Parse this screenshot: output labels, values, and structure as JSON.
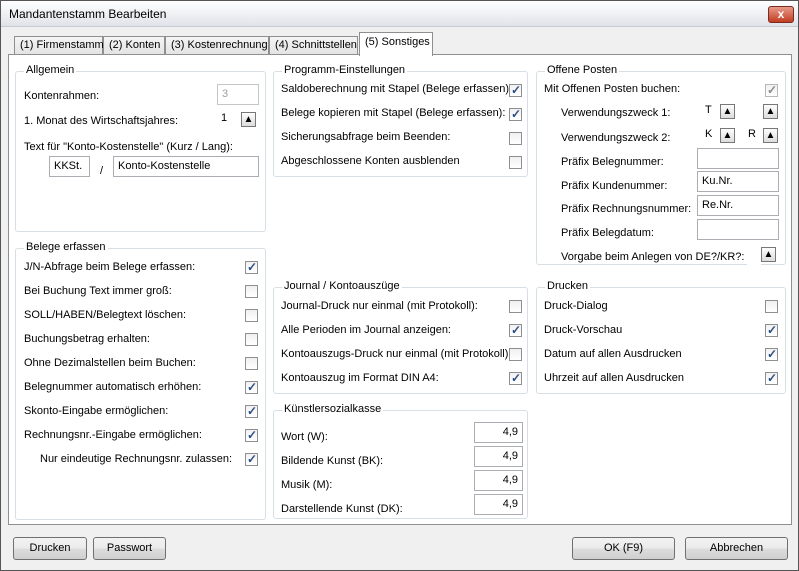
{
  "window": {
    "title": "Mandantenstamm Bearbeiten",
    "close": "x"
  },
  "tabs": [
    "(1) Firmenstamm",
    "(2) Konten",
    "(3) Kostenrechnung",
    "(4) Schnittstellen",
    "(5) Sonstiges"
  ],
  "allgemein": {
    "title": "Allgemein",
    "kontenrahmen_label": "Kontenrahmen:",
    "kontenrahmen_value": "3",
    "monat_label": "1. Monat des Wirtschaftsjahres:",
    "monat_value": "1",
    "text_label": "Text für \"Konto-Kostenstelle\" (Kurz / Lang):",
    "kurz_value": "KKSt.",
    "separator": "/",
    "lang_value": "Konto-Kostenstelle"
  },
  "programm": {
    "title": "Programm-Einstellungen",
    "items": [
      {
        "label": "Saldoberechnung mit Stapel (Belege erfassen):",
        "checked": true
      },
      {
        "label": "Belege kopieren mit Stapel (Belege erfassen):",
        "checked": true
      },
      {
        "label": "Sicherungsabfrage beim Beenden:",
        "checked": false
      },
      {
        "label": "Abgeschlossene Konten ausblenden",
        "checked": false
      }
    ]
  },
  "offene": {
    "title": "Offene Posten",
    "buchen_label": "Mit Offenen Posten buchen:",
    "buchen_checked": true,
    "vz1_label": "Verwendungszweck 1:",
    "vz1_a": "T",
    "vz1_b": "",
    "vz2_label": "Verwendungszweck 2:",
    "vz2_a": "K",
    "vz2_b": "R",
    "belegnr_label": "Präfix Belegnummer:",
    "belegnr_value": "",
    "kundennr_label": "Präfix Kundenummer:",
    "kundennr_value": "Ku.Nr.",
    "rechnungsnr_label": "Präfix Rechnungsnummer:",
    "rechnungsnr_value": "Re.Nr.",
    "belegdatum_label": "Präfix Belegdatum:",
    "belegdatum_value": "",
    "vorgabe_label": "Vorgabe beim Anlegen von DE?/KR?:",
    "vorgabe_value": ""
  },
  "belege": {
    "title": "Belege erfassen",
    "items": [
      {
        "label": "J/N-Abfrage beim Belege erfassen:",
        "checked": true
      },
      {
        "label": "Bei Buchung Text immer groß:",
        "checked": false
      },
      {
        "label": "SOLL/HABEN/Belegtext löschen:",
        "checked": false
      },
      {
        "label": "Buchungsbetrag erhalten:",
        "checked": false
      },
      {
        "label": "Ohne Dezimalstellen beim Buchen:",
        "checked": false
      },
      {
        "label": "Belegnummer automatisch erhöhen:",
        "checked": true
      },
      {
        "label": "Skonto-Eingabe ermöglichen:",
        "checked": true
      },
      {
        "label": "Rechnungsnr.-Eingabe ermöglichen:",
        "checked": true
      },
      {
        "label": "Nur eindeutige Rechnungsnr. zulassen:",
        "checked": true
      }
    ]
  },
  "journal": {
    "title": "Journal / Kontoauszüge",
    "items": [
      {
        "label": "Journal-Druck nur einmal (mit Protokoll):",
        "checked": false
      },
      {
        "label": "Alle Perioden im Journal anzeigen:",
        "checked": true
      },
      {
        "label": "Kontoauszugs-Druck nur einmal (mit Protokoll):",
        "checked": false
      },
      {
        "label": "Kontoauszug im Format DIN A4:",
        "checked": true
      }
    ]
  },
  "drucken": {
    "title": "Drucken",
    "items": [
      {
        "label": "Druck-Dialog",
        "checked": false
      },
      {
        "label": "Druck-Vorschau",
        "checked": true
      },
      {
        "label": "Datum auf allen Ausdrucken",
        "checked": true
      },
      {
        "label": "Uhrzeit auf allen Ausdrucken",
        "checked": true
      }
    ]
  },
  "kuenstler": {
    "title": "Künstlersozialkasse",
    "items": [
      {
        "label": "Wort (W):",
        "value": "4,9"
      },
      {
        "label": "Bildende Kunst (BK):",
        "value": "4,9"
      },
      {
        "label": "Musik (M):",
        "value": "4,9"
      },
      {
        "label": "Darstellende Kunst (DK):",
        "value": "4,9"
      }
    ]
  },
  "buttons": {
    "drucken": "Drucken",
    "passwort": "Passwort",
    "ok": "OK (F9)",
    "abbrechen": "Abbrechen"
  },
  "icons": {
    "spin_up": "▲"
  }
}
